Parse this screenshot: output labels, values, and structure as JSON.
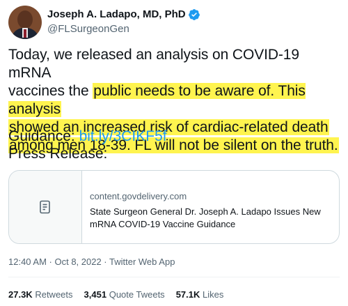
{
  "author": {
    "name": "Joseph A. Ladapo, MD, PhD",
    "handle": "@FLSurgeonGen",
    "verified": true
  },
  "tweet": {
    "lines": [
      {
        "plain": "Today, we released an analysis on COVID-19 mRNA",
        "hl": ""
      },
      {
        "plain": "vaccines the ",
        "hl": "public needs to be aware of. This analysis"
      },
      {
        "plain": "",
        "hl": "showed an increased risk of cardiac-related death"
      },
      {
        "plain": "",
        "hl": "among men 18-39. FL will not be silent on the truth."
      }
    ],
    "guidance_label": "Guidance:",
    "guidance_link": "bit.ly/3CIKF5f",
    "press_label": "Press Release:"
  },
  "card": {
    "domain": "content.govdelivery.com",
    "title": "State Surgeon General Dr. Joseph A. Ladapo Issues New mRNA COVID-19 Vaccine Guidance",
    "icon": "document-icon"
  },
  "meta": {
    "timestamp": "12:40 AM · Oct 8, 2022 · Twitter Web App"
  },
  "stats": {
    "retweets_count": "27.3K",
    "retweets_label": "Retweets",
    "quotes_count": "3,451",
    "quotes_label": "Quote Tweets",
    "likes_count": "57.1K",
    "likes_label": "Likes"
  },
  "colors": {
    "highlight": "#fff44f",
    "link": "#1d9bf0",
    "secondary_text": "#536471",
    "verified": "#1d9bf0"
  }
}
